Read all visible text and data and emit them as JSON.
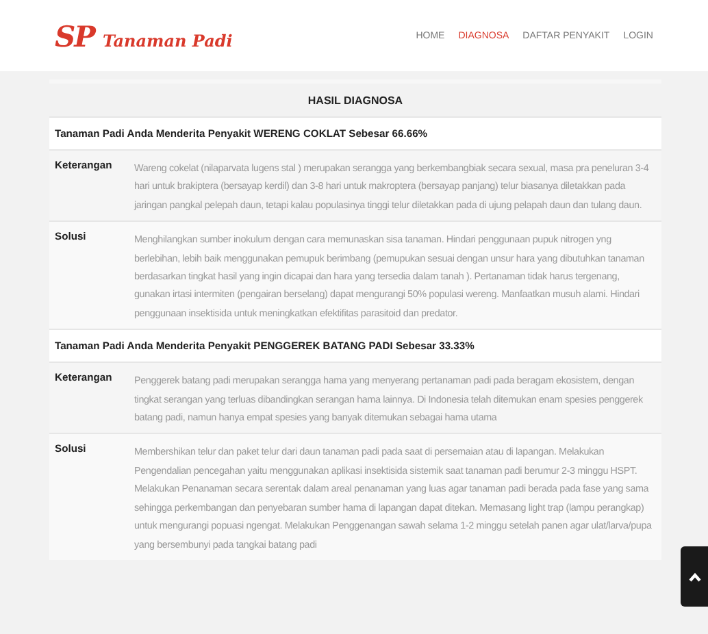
{
  "logo": {
    "initials": "SP",
    "name": "Tanaman Padi"
  },
  "nav": [
    {
      "label": "HOME",
      "selected": false
    },
    {
      "label": "DIAGNOSA",
      "selected": true
    },
    {
      "label": "DAFTAR PENYAKIT",
      "selected": false
    },
    {
      "label": "LOGIN",
      "selected": false
    }
  ],
  "heading": "HASIL DIAGNOSA",
  "results": [
    {
      "title": "Tanaman Padi Anda Menderita Penyakit WERENG COKLAT Sebesar 66.66%",
      "rows": [
        {
          "label": "Keterangan",
          "text": "Wareng cokelat (nilaparvata lugens stal ) merupakan serangga yang berkembangbiak secara sexual, masa pra peneluran 3-4 hari untuk brakiptera (bersayap kerdil) dan 3-8 hari untuk makroptera (bersayap panjang) telur biasanya diletakkan pada jaringan pangkal pelepah daun, tetapi kalau populasinya tinggi telur diletakkan pada di ujung pelapah daun dan tulang daun."
        },
        {
          "label": "Solusi",
          "text": "Menghilangkan sumber inokulum dengan cara memunaskan sisa tanaman. Hindari penggunaan pupuk nitrogen yng berlebihan, lebih baik menggunakan pemupuk berimbang (pemupukan sesuai dengan unsur hara yang dibutuhkan tanaman berdasarkan tingkat hasil yang ingin dicapai dan hara yang tersedia dalam tanah ). Pertanaman tidak harus tergenang, gunakan irtasi intermiten (pengairan berselang) dapat mengurangi 50% populasi wereng. Manfaatkan musuh alami. Hindari penggunaan insektisida untuk meningkatkan efektifitas parasitoid dan predator."
        }
      ]
    },
    {
      "title": "Tanaman Padi Anda Menderita Penyakit PENGGEREK BATANG PADI Sebesar 33.33%",
      "rows": [
        {
          "label": "Keterangan",
          "text": "Penggerek batang padi merupakan serangga hama yang menyerang pertanaman padi pada beragam ekosistem, dengan tingkat serangan yang terluas dibandingkan serangan hama lainnya. Di Indonesia telah ditemukan enam spesies penggerek batang padi, namun hanya empat spesies yang banyak ditemukan sebagai hama utama"
        },
        {
          "label": "Solusi",
          "text": "Membershikan telur dan paket telur dari daun tanaman padi pada saat di persemaian atau di lapangan. Melakukan Pengendalian pencegahan yaitu menggunakan aplikasi insektisida sistemik saat tanaman padi berumur 2-3 minggu HSPT. Melakukan Penanaman secara serentak dalam areal penanaman yang luas agar tanaman padi berada pada fase yang sama sehingga perkembangan dan penyebaran sumber hama di lapangan dapat ditekan. Memasang light trap (lampu perangkap) untuk mengurangi popuasi ngengat. Melakukan Penggenangan sawah selama 1-2 minggu setelah panen agar ulat/larva/pupa yang bersembunyi pada tangkai batang padi"
        }
      ]
    }
  ]
}
